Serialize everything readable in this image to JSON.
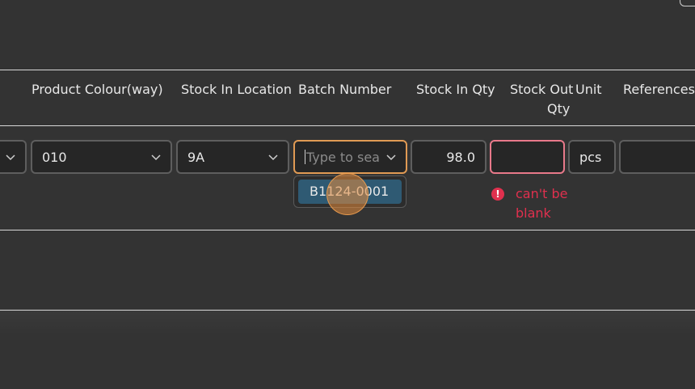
{
  "headers": {
    "product_colour": "Product Colour(way)",
    "stock_in_location": "Stock In Location",
    "batch_number": "Batch Number",
    "stock_in_qty": "Stock In Qty",
    "stock_out_qty_line1": "Stock Out",
    "stock_out_qty_line2": "Qty",
    "unit": "Unit",
    "references": "References"
  },
  "row": {
    "product_colour_value": "010",
    "stock_in_location_value": "9A",
    "batch_number_placeholder": "Type to sea",
    "stock_in_qty_value": "98.0",
    "stock_out_qty_value": "",
    "unit_value": "pcs",
    "references_value": ""
  },
  "dropdown": {
    "options": [
      "B1124-0001"
    ]
  },
  "validation": {
    "stock_out_error": "can't be blank"
  },
  "colors": {
    "background": "#333333",
    "focus_border": "#e09a54",
    "error": "#e0304e",
    "option_highlight": "#2f5a73"
  },
  "icons": {
    "dropdown": "chevron-down-icon",
    "error": "exclamation-circle-icon"
  }
}
